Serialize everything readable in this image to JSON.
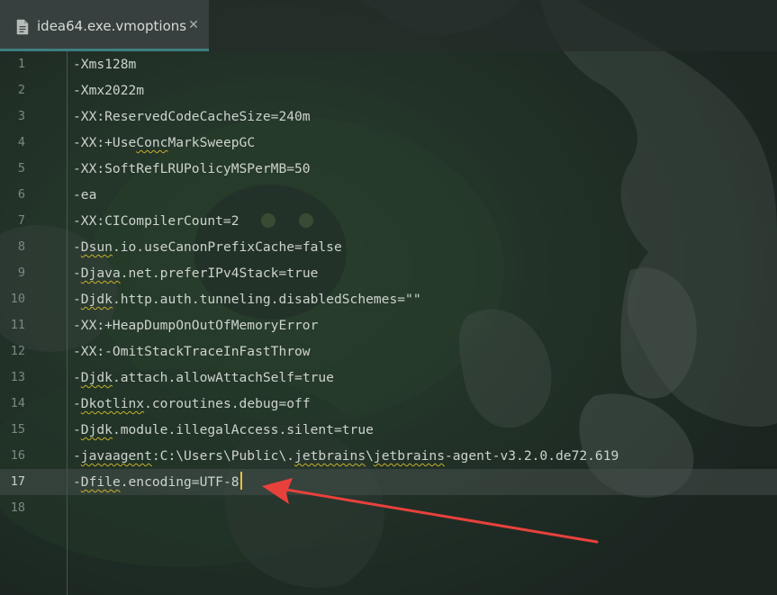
{
  "tab": {
    "file_name": "idea64.exe.vmoptions",
    "close_glyph": "✕",
    "file_icon": "file-text-icon",
    "accent_color": "#3e7e7f"
  },
  "editor": {
    "current_line": 17,
    "lines": [
      {
        "number": "1",
        "parts": [
          "-Xms128m"
        ]
      },
      {
        "number": "2",
        "parts": [
          "-Xmx2022m"
        ]
      },
      {
        "number": "3",
        "parts": [
          "-XX:ReservedCodeCacheSize=240m"
        ]
      },
      {
        "number": "4",
        "parts": [
          "-XX:+Use",
          "Conc",
          "MarkSweepGC"
        ]
      },
      {
        "number": "5",
        "parts": [
          "-XX:SoftRefLRUPolicyMSPerMB=50"
        ]
      },
      {
        "number": "6",
        "parts": [
          "-ea"
        ]
      },
      {
        "number": "7",
        "parts": [
          "-XX:CICompilerCount=2"
        ]
      },
      {
        "number": "8",
        "parts": [
          "-",
          "Dsun",
          ".io.useCanonPrefixCache=false"
        ]
      },
      {
        "number": "9",
        "parts": [
          "-",
          "Djava",
          ".net.preferIPv4Stack=true"
        ]
      },
      {
        "number": "10",
        "parts": [
          "-",
          "Djdk",
          ".http.auth.tunneling.disabledSchemes=\"\""
        ]
      },
      {
        "number": "11",
        "parts": [
          "-XX:+HeapDumpOnOutOfMemoryError"
        ]
      },
      {
        "number": "12",
        "parts": [
          "-XX:-OmitStackTraceInFastThrow"
        ]
      },
      {
        "number": "13",
        "parts": [
          "-",
          "Djdk",
          ".attach.allowAttachSelf=true"
        ]
      },
      {
        "number": "14",
        "parts": [
          "-",
          "Dkotlinx",
          ".coroutines.debug=off"
        ]
      },
      {
        "number": "15",
        "parts": [
          "-",
          "Djdk",
          ".module.illegalAccess.silent=true"
        ]
      },
      {
        "number": "16",
        "parts": [
          "-",
          "javaagent",
          ":C:\\Users\\Public\\.",
          "jetbrains",
          "\\",
          "jetbrains",
          "-agent-v3.2.0.de72.619"
        ]
      },
      {
        "number": "17",
        "parts": [
          "-",
          "Dfile",
          ".encoding=UTF-8"
        ]
      },
      {
        "number": "18",
        "parts": [
          ""
        ]
      }
    ]
  },
  "colors": {
    "code_text": "#cdd3cd",
    "line_number": "#7f8783",
    "squiggle": "#c6b02c",
    "caret": "#e6c33a",
    "annotation_arrow": "#e8413c"
  }
}
